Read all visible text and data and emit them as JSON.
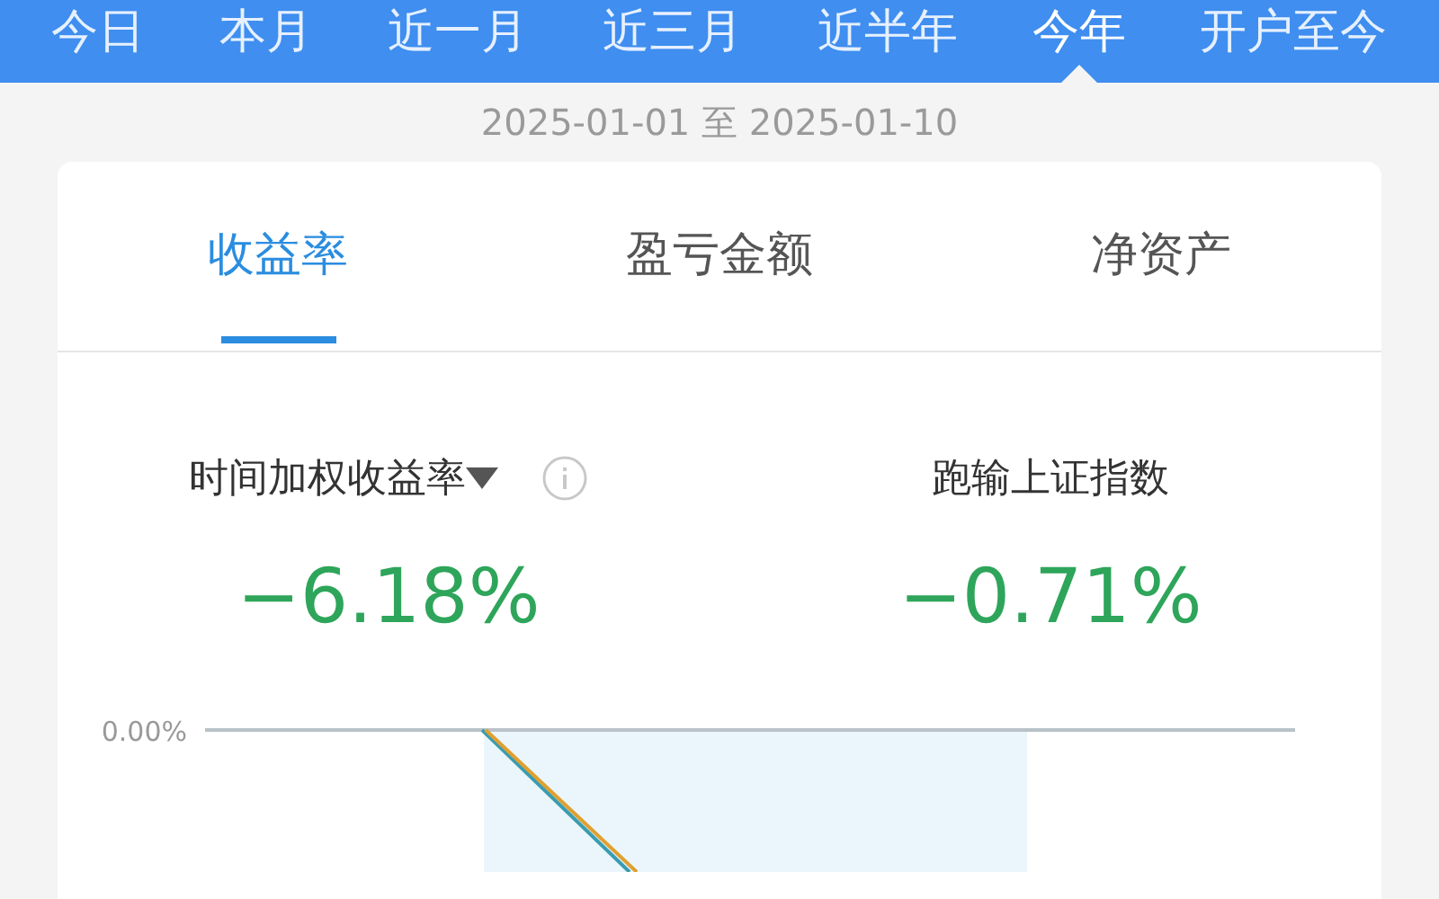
{
  "period_tabs": [
    {
      "label": "今日",
      "selected": false
    },
    {
      "label": "本月",
      "selected": false
    },
    {
      "label": "近一月",
      "selected": false
    },
    {
      "label": "近三月",
      "selected": false
    },
    {
      "label": "近半年",
      "selected": false
    },
    {
      "label": "今年",
      "selected": true
    },
    {
      "label": "开户至今",
      "selected": false
    }
  ],
  "date_range": "2025-01-01 至 2025-01-10",
  "card_tabs": [
    {
      "label": "收益率",
      "selected": true
    },
    {
      "label": "盈亏金额",
      "selected": false
    },
    {
      "label": "净资产",
      "selected": false
    }
  ],
  "metrics": [
    {
      "label": "时间加权收益率",
      "dropdown": true,
      "info": true,
      "value": "−6.18%"
    },
    {
      "label": "跑输上证指数",
      "dropdown": false,
      "info": false,
      "value": "−0.71%"
    }
  ],
  "chart": {
    "axis_label": "0.00%"
  }
}
